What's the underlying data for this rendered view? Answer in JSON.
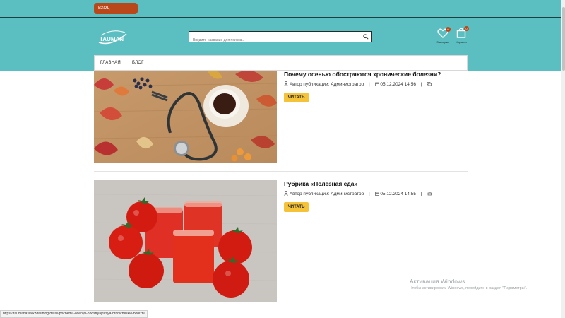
{
  "topbar": {
    "login_label": "ВХОД"
  },
  "header": {
    "logo_text": "TAUMAN",
    "search_placeholder": "Введите название для поиска...",
    "wishlist": {
      "label": "Закладки",
      "count": "0"
    },
    "cart": {
      "label": "Корзина",
      "count": "0"
    }
  },
  "nav": {
    "items": [
      "ГЛАВНАЯ",
      "БЛОГ"
    ]
  },
  "posts": [
    {
      "title": "Почему осенью обостряются хронические болезни?",
      "author": "Автор публикации: Администратор",
      "date": "05.12.2024 14:56",
      "read_label": "ЧИТАТЬ"
    },
    {
      "title": "Рубрика «Полезная еда»",
      "author": "Автор публикации: Администратор",
      "date": "05.12.2024 14:55",
      "read_label": "ЧИТАТЬ"
    }
  ],
  "status_url": "https://taumanasia.kz/taublog/detail/pochemu-osenyu-obostryayutsya-hronicheskie-bolezni",
  "watermark": {
    "title": "Активация Windows",
    "subtitle": "Чтобы активировать Windows, перейдите в раздел \"Параметры\"."
  }
}
